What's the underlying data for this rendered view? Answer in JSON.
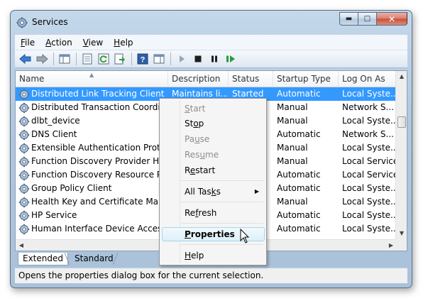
{
  "window": {
    "title": "Services",
    "title_icon": "services-gear-icon"
  },
  "caption_buttons": {
    "minimize": "minimize-icon",
    "maximize": "maximize-icon",
    "close": "close-icon"
  },
  "menubar": {
    "items": [
      {
        "label": "File",
        "u": "F",
        "rest": "ile"
      },
      {
        "label": "Action",
        "u": "A",
        "rest": "ction"
      },
      {
        "label": "View",
        "u": "V",
        "rest": "iew"
      },
      {
        "label": "Help",
        "u": "H",
        "rest": "elp"
      }
    ]
  },
  "toolbar": {
    "buttons": [
      "back-arrow-icon",
      "forward-arrow-icon",
      "show-hide-console-tree-icon",
      "properties-icon",
      "refresh-icon",
      "export-list-icon",
      "help-icon",
      "show-action-pane-icon",
      "start-service-icon",
      "stop-service-icon",
      "pause-service-icon",
      "restart-service-icon"
    ]
  },
  "list": {
    "columns": [
      "Name",
      "Description",
      "Status",
      "Startup Type",
      "Log On As"
    ],
    "rows": [
      {
        "name": "Distributed Link Tracking Client",
        "description": "Maintains li...",
        "status": "Started",
        "startup": "Automatic",
        "logon": "Local Syste...",
        "selected": true
      },
      {
        "name": "Distributed Transaction Coordinator",
        "description": "",
        "status": "",
        "startup": "Manual",
        "logon": "Network S..."
      },
      {
        "name": "dlbt_device",
        "description": "",
        "status": "",
        "startup": "Manual",
        "logon": "Local Syste..."
      },
      {
        "name": "DNS Client",
        "description": "",
        "status": "",
        "startup": "Automatic",
        "logon": "Network S..."
      },
      {
        "name": "Extensible Authentication Protocol",
        "description": "",
        "status": "",
        "startup": "Manual",
        "logon": "Local Syste..."
      },
      {
        "name": "Function Discovery Provider Host",
        "description": "",
        "status": "",
        "startup": "Manual",
        "logon": "Local Service"
      },
      {
        "name": "Function Discovery Resource Publication",
        "description": "",
        "status": "",
        "startup": "Automatic",
        "logon": "Local Service"
      },
      {
        "name": "Group Policy Client",
        "description": "",
        "status": "",
        "startup": "Automatic",
        "logon": "Local Syste..."
      },
      {
        "name": "Health Key and Certificate Management",
        "description": "",
        "status": "",
        "startup": "Manual",
        "logon": "Local Syste..."
      },
      {
        "name": "HP Service",
        "description": "",
        "status": "",
        "startup": "Automatic",
        "logon": "Local Syste..."
      },
      {
        "name": "Human Interface Device Access",
        "description": "",
        "status": "",
        "startup": "Automatic",
        "logon": "Local Syste..."
      }
    ]
  },
  "tabs": {
    "extended": "Extended",
    "standard": "Standard"
  },
  "statusbar": {
    "text": "Opens the properties dialog box for the current selection."
  },
  "context_menu": {
    "start": {
      "pre": "",
      "u": "S",
      "post": "tart"
    },
    "stop": {
      "pre": "St",
      "u": "o",
      "post": "p"
    },
    "pause": {
      "pre": "Pa",
      "u": "u",
      "post": "se"
    },
    "resume": {
      "pre": "Res",
      "u": "u",
      "post": "me"
    },
    "restart": {
      "pre": "R",
      "u": "e",
      "post": "start"
    },
    "all_tasks": {
      "pre": "All Tas",
      "u": "k",
      "post": "s"
    },
    "refresh": {
      "pre": "Re",
      "u": "f",
      "post": "resh"
    },
    "properties": {
      "pre": "",
      "u": "P",
      "post": "roperties"
    },
    "help": {
      "pre": "",
      "u": "H",
      "post": "elp"
    }
  }
}
